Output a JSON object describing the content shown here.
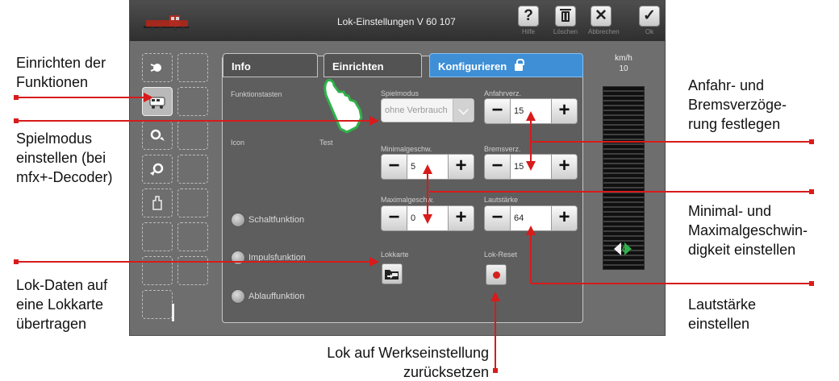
{
  "header": {
    "title": "Lok-Einstellungen V 60 107",
    "buttons": [
      {
        "icon": "help-icon",
        "glyph": "?",
        "label": "Hilfe"
      },
      {
        "icon": "trash-icon",
        "glyph": "",
        "label": "Löschen"
      },
      {
        "icon": "close-icon",
        "glyph": "✕",
        "label": "Abbrechen"
      },
      {
        "icon": "check-icon",
        "glyph": "✓",
        "label": "Ok"
      }
    ]
  },
  "tabs": [
    {
      "label": "Info",
      "active": false
    },
    {
      "label": "Einrichten",
      "active": false
    },
    {
      "label": "Konfigurieren",
      "active": true,
      "icon": "lock-icon"
    }
  ],
  "panel": {
    "functions_heading": "Funktionstasten",
    "icon_label": "Icon",
    "test_label": "Test",
    "function_types": [
      "Schaltfunktion",
      "Impulsfunktion",
      "Ablauffunktion"
    ],
    "play_mode": {
      "label": "Spielmodus",
      "value": "ohne Verbrauch"
    },
    "min_speed": {
      "label": "Minimalgeschw.",
      "value": "5"
    },
    "max_speed": {
      "label": "Maximalgeschw.",
      "value": "0"
    },
    "accel_delay": {
      "label": "Anfahrverz.",
      "value": "15"
    },
    "brake_delay": {
      "label": "Bremsverz.",
      "value": "15"
    },
    "volume": {
      "label": "Lautstärke",
      "value": "64"
    },
    "loco_card": {
      "label": "Lokkarte"
    },
    "loco_reset": {
      "label": "Lok-Reset"
    }
  },
  "speedometer": {
    "unit": "km/h",
    "speed": "10",
    "readout": "0"
  },
  "annotations": {
    "einrichten": [
      "Einrichten der",
      "Funktionen"
    ],
    "spielmodus": [
      "Spielmodus",
      "einstellen (bei",
      "mfx+-Decoder)"
    ],
    "lokdaten": [
      "Lok-Daten auf",
      "eine Lokkarte",
      "übertragen"
    ],
    "anfahr": [
      "Anfahr- und",
      "Bremsverzöge-",
      "rung festlegen"
    ],
    "minmax": [
      "Minimal- und",
      "Maximalgeschwin-",
      "digkeit einstellen"
    ],
    "laut": [
      "Lautstärke",
      "einstellen"
    ],
    "werk": [
      "Lok auf Werkseinstellung",
      "zurücksetzen"
    ]
  },
  "colors": {
    "accent_blue": "#3f8fd6",
    "annotation_red": "#d81b1b",
    "speed_green": "#35c24a"
  }
}
